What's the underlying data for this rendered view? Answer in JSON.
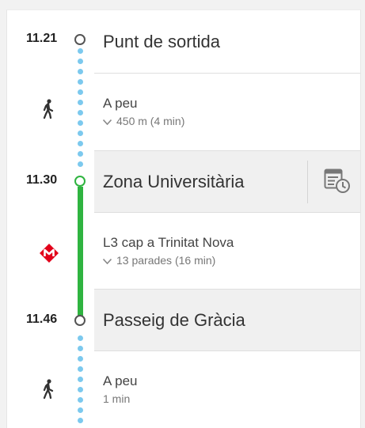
{
  "itinerary": {
    "start": {
      "time": "11.21",
      "name": "Punt de sortida"
    },
    "walk1": {
      "mode": "A peu",
      "detail": "450 m (4 min)"
    },
    "board": {
      "time": "11.30",
      "name": "Zona Universitària"
    },
    "metro": {
      "line": "L3 cap a Trinitat Nova",
      "detail": "13 parades (16 min)"
    },
    "alight": {
      "time": "11.46",
      "name": "Passeig de Gràcia"
    },
    "walk2": {
      "mode": "A peu",
      "detail": "1 min"
    }
  },
  "icons": {
    "walk": "pedestrian-icon",
    "metro": "metro-logo-icon",
    "schedule": "schedule-icon",
    "chevron": "chevron-down-icon"
  },
  "colors": {
    "line_green": "#2fb440",
    "walk_dots": "#7cc9ee",
    "metro_red": "#e2001a"
  }
}
